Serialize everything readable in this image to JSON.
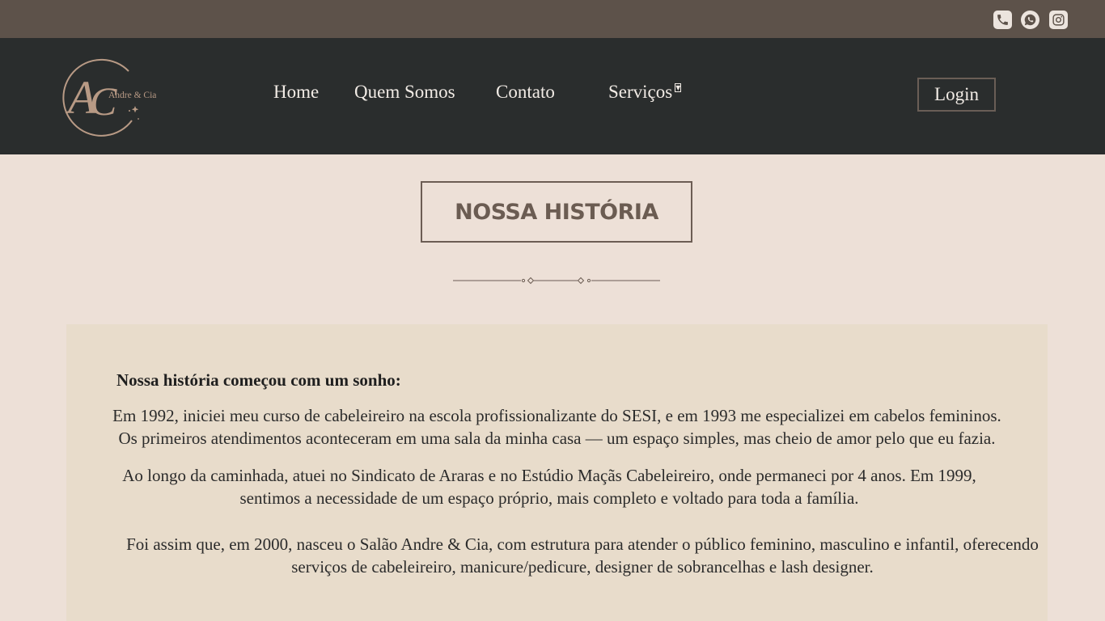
{
  "topbar": {
    "icons": [
      "phone-icon",
      "whatsapp-icon",
      "instagram-icon"
    ],
    "background": "#5d524a"
  },
  "header": {
    "logo": {
      "monogram": "AC",
      "name": "Andre & Cia"
    },
    "nav": {
      "home": "Home",
      "quem_somos": "Quem Somos",
      "contato": "Contato",
      "servicos": "Serviços"
    },
    "login": "Login",
    "background": "#2a2d2d"
  },
  "main": {
    "title": "NOSSA HISTÓRIA",
    "story_heading": "Nossa história começou com um sonho:",
    "paragraph1": [
      "Em 1992, iniciei meu curso de cabeleireiro na escola profissionalizante do SESI, e em 1993 me especializei em cabelos femininos.",
      "Os primeiros atendimentos aconteceram em uma sala da minha casa — um espaço simples, mas cheio de amor pelo que eu fazia."
    ],
    "paragraph2": [
      "Ao longo da caminhada, atuei no Sindicato de Araras e no Estúdio Maçãs Cabeleireiro, onde permaneci por 4 anos. Em 1999,",
      "sentimos a necessidade de um espaço próprio, mais completo e voltado para toda a família."
    ],
    "paragraph3": [
      "Foi assim que, em 2000, nasceu o Salão Andre & Cia, com estrutura para atender o público feminino, masculino e infantil, oferecendo",
      "serviços de cabeleireiro, manicure/pedicure, designer de sobrancelhas e lash designer."
    ]
  },
  "colors": {
    "page_background": "#ede0d7",
    "card_background": "#e8dccb",
    "title_color": "#6b5c52",
    "logo_accent": "#b89a85"
  }
}
